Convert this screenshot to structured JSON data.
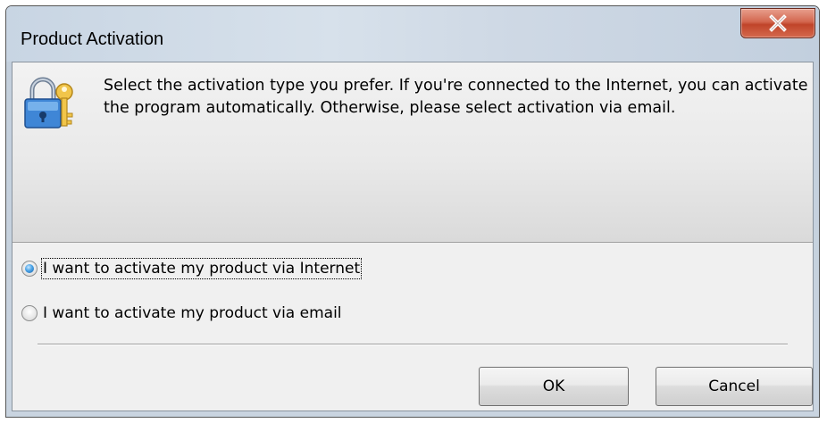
{
  "window": {
    "title": "Product Activation",
    "close_icon": "close-x-icon"
  },
  "banner": {
    "icon": "lock-key-icon",
    "text": "Select the activation type you prefer. If you're connected to the Internet, you can activate the program automatically. Otherwise, please select activation via email."
  },
  "options": [
    {
      "label": "I want to activate my product via Internet",
      "selected": true
    },
    {
      "label": "I want to activate my product via email",
      "selected": false
    }
  ],
  "buttons": {
    "ok": "OK",
    "cancel": "Cancel"
  },
  "colors": {
    "close_button": "#c7462c",
    "radio_selected": "#2a7bc8"
  }
}
